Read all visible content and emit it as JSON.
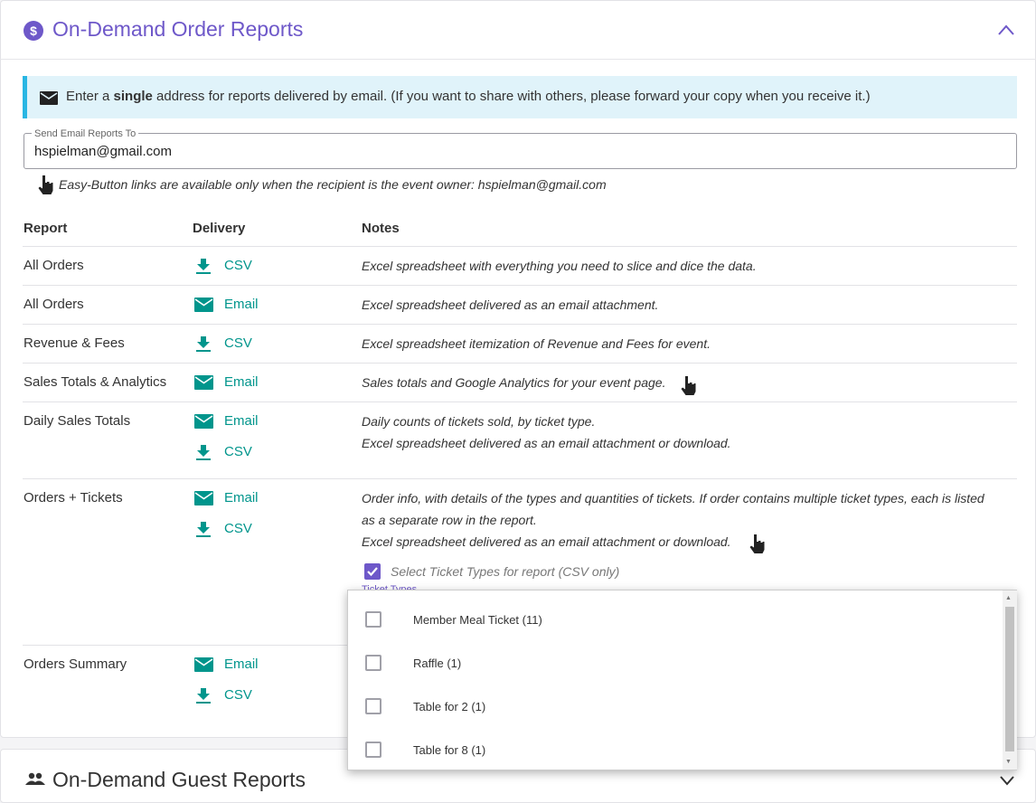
{
  "header": {
    "title": "On-Demand Order Reports",
    "icon": "dollar-circle-icon",
    "toggle_icon": "chevron-up-icon",
    "accent_color": "#6e58c9"
  },
  "banner": {
    "text_before": "Enter a ",
    "text_bold": "single",
    "text_after": " address for reports delivered by email. (If you want to share with others, please forward your copy when you receive it.)",
    "icon": "envelope-icon"
  },
  "email_field": {
    "label": "Send Email Reports To",
    "value": "hspielman@gmail.com"
  },
  "easy_note": "Easy-Button links are available only when the recipient is the event owner: hspielman@gmail.com",
  "table": {
    "headers": [
      "Report",
      "Delivery",
      "Notes"
    ],
    "link_color": "#00958c",
    "rows": [
      {
        "report": "All Orders",
        "delivery": [
          "CSV"
        ],
        "notes": [
          "Excel spreadsheet with everything you need to slice and dice the data."
        ]
      },
      {
        "report": "All Orders",
        "delivery": [
          "Email"
        ],
        "notes": [
          "Excel spreadsheet delivered as an email attachment."
        ]
      },
      {
        "report": "Revenue & Fees",
        "delivery": [
          "CSV"
        ],
        "notes": [
          "Excel spreadsheet itemization of Revenue and Fees for event."
        ]
      },
      {
        "report": "Sales Totals & Analytics",
        "delivery": [
          "Email"
        ],
        "notes": [
          "Sales totals and Google Analytics for your event page."
        ]
      },
      {
        "report": "Daily Sales Totals",
        "delivery": [
          "Email",
          "CSV"
        ],
        "notes": [
          "Daily counts of tickets sold, by ticket type.",
          "Excel spreadsheet delivered as an email attachment or download."
        ]
      },
      {
        "report": "Orders + Tickets",
        "delivery": [
          "Email",
          "CSV"
        ],
        "notes": [
          "Order info, with details of the types and quantities of tickets. If order contains multiple ticket types, each is listed",
          "as a separate row in the report.",
          "Excel spreadsheet delivered as an email attachment or download."
        ]
      },
      {
        "report": "Orders Summary",
        "delivery": [
          "Email",
          "CSV"
        ],
        "notes": []
      }
    ]
  },
  "ticket_select": {
    "checked": true,
    "label": "Select Ticket Types for report (CSV only)",
    "peek_text": "Ticket Types"
  },
  "dropdown": {
    "options": [
      {
        "label": "Member Meal Ticket (11)",
        "checked": false
      },
      {
        "label": "Raffle (1)",
        "checked": false
      },
      {
        "label": "Table for 2 (1)",
        "checked": false
      },
      {
        "label": "Table for 8 (1)",
        "checked": false
      }
    ]
  },
  "guest_panel": {
    "title": "On-Demand Guest Reports",
    "icon": "people-icon",
    "toggle_icon": "chevron-down-icon"
  }
}
